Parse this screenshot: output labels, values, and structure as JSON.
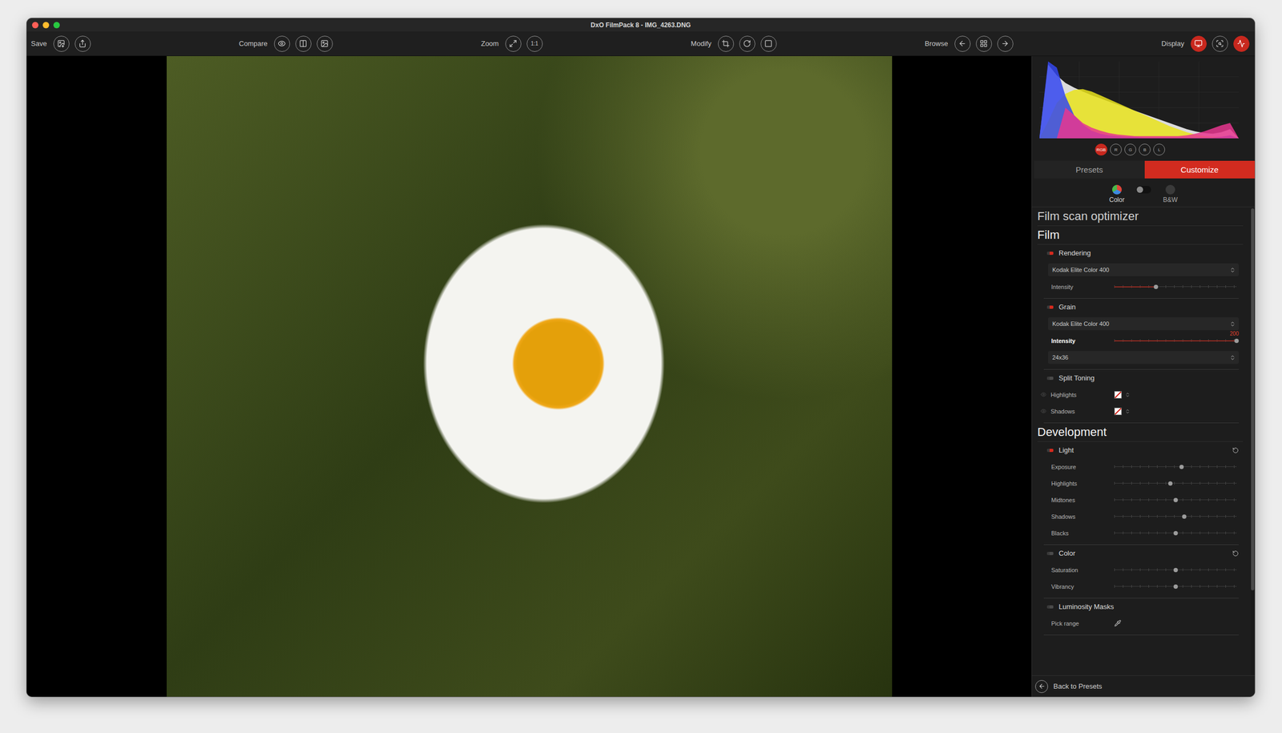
{
  "window": {
    "title": "DxO FilmPack 8 - IMG_4263.DNG"
  },
  "toolbar": {
    "groups": [
      {
        "label": "Save",
        "buttons": [
          {
            "text": "",
            "active": false
          },
          {
            "text": "",
            "active": false
          }
        ]
      },
      {
        "label": "Compare",
        "buttons": [
          {
            "text": "",
            "active": false
          },
          {
            "text": "",
            "active": false
          },
          {
            "text": "",
            "active": false
          }
        ]
      },
      {
        "label": "Zoom",
        "buttons": [
          {
            "text": "",
            "active": false
          },
          {
            "text": "1:1",
            "active": false
          }
        ]
      },
      {
        "label": "Modify",
        "buttons": [
          {
            "text": "",
            "active": false
          },
          {
            "text": "",
            "active": false
          },
          {
            "text": "",
            "active": false
          }
        ]
      },
      {
        "label": "Browse",
        "buttons": [
          {
            "text": "",
            "active": false
          },
          {
            "text": "",
            "active": false
          },
          {
            "text": "",
            "active": false
          }
        ]
      },
      {
        "label": "Display",
        "buttons": [
          {
            "text": "",
            "active": true
          },
          {
            "text": "",
            "active": false
          },
          {
            "text": "",
            "active": true
          }
        ]
      }
    ]
  },
  "histogram": {
    "series": [
      {
        "color": "#e6e6e6",
        "values": [
          0,
          96,
          82,
          72,
          66,
          61,
          56,
          52,
          48,
          44,
          40,
          36,
          32,
          28,
          24,
          20,
          16,
          12,
          9,
          7,
          6,
          8,
          12,
          0
        ]
      },
      {
        "color": "#e9e31c",
        "values": [
          0,
          22,
          46,
          58,
          63,
          64,
          61,
          56,
          51,
          46,
          41,
          36,
          31,
          26,
          21,
          16,
          12,
          8,
          5,
          3,
          2,
          2,
          2,
          0
        ]
      },
      {
        "color": "#3447f0",
        "values": [
          2,
          100,
          92,
          55,
          30,
          18,
          10,
          6,
          4,
          3,
          2,
          2,
          1,
          1,
          1,
          1,
          1,
          1,
          1,
          1,
          1,
          2,
          4,
          0
        ]
      },
      {
        "color": "#e8368f",
        "values": [
          0,
          0,
          0,
          40,
          30,
          20,
          14,
          10,
          7,
          5,
          4,
          3,
          3,
          3,
          3,
          3,
          3,
          4,
          6,
          9,
          13,
          17,
          20,
          0
        ]
      }
    ],
    "channels": [
      {
        "label": "RGB",
        "selected": true
      },
      {
        "label": "R",
        "selected": false
      },
      {
        "label": "G",
        "selected": false
      },
      {
        "label": "B",
        "selected": false
      },
      {
        "label": "L",
        "selected": false
      }
    ]
  },
  "tabs": [
    {
      "label": "Presets",
      "selected": false
    },
    {
      "label": "Customize",
      "selected": true
    }
  ],
  "mode": [
    {
      "label": "Color",
      "selected": true
    },
    {
      "label": "B&W",
      "selected": false
    }
  ],
  "sections": [
    {
      "title": "Film scan optimizer",
      "expanded": false,
      "groups": []
    },
    {
      "title": "Film",
      "expanded": true,
      "groups": [
        {
          "title": "Rendering",
          "enabled": true,
          "resettable": false,
          "rows": [
            {
              "kind": "select",
              "label": "",
              "value": "Kodak Elite Color 400"
            },
            {
              "kind": "slider",
              "label": "Intensity",
              "level": 0.34,
              "reading": "",
              "emphasized": false
            }
          ]
        },
        {
          "title": "Grain",
          "enabled": true,
          "resettable": false,
          "rows": [
            {
              "kind": "select",
              "label": "",
              "value": "Kodak Elite Color 400"
            },
            {
              "kind": "slider",
              "label": "Intensity",
              "level": 1,
              "reading": "200",
              "emphasized": true
            },
            {
              "kind": "select",
              "label": "",
              "value": "24x36"
            }
          ]
        },
        {
          "title": "Split Toning",
          "enabled": false,
          "resettable": false,
          "rows": [
            {
              "kind": "color",
              "label": "Highlights"
            },
            {
              "kind": "color",
              "label": "Shadows"
            }
          ]
        }
      ]
    },
    {
      "title": "Development",
      "expanded": true,
      "groups": [
        {
          "title": "Light",
          "enabled": true,
          "resettable": true,
          "rows": [
            {
              "kind": "centered-slider",
              "label": "Exposure",
              "level": 0.55,
              "reading": "",
              "emphasized": false
            },
            {
              "kind": "centered-slider",
              "label": "Highlights",
              "level": 0.46,
              "reading": "",
              "emphasized": false
            },
            {
              "kind": "centered-slider",
              "label": "Midtones",
              "level": 0.5,
              "reading": "",
              "emphasized": false
            },
            {
              "kind": "centered-slider",
              "label": "Shadows",
              "level": 0.57,
              "reading": "",
              "emphasized": false
            },
            {
              "kind": "centered-slider",
              "label": "Blacks",
              "level": 0.5,
              "reading": "",
              "emphasized": false
            }
          ]
        },
        {
          "title": "Color",
          "enabled": false,
          "resettable": true,
          "rows": [
            {
              "kind": "centered-slider",
              "label": "Saturation",
              "level": 0.5,
              "reading": "",
              "emphasized": false
            },
            {
              "kind": "centered-slider",
              "label": "Vibrancy",
              "level": 0.5,
              "reading": "",
              "emphasized": false
            }
          ]
        },
        {
          "title": "Luminosity Masks",
          "enabled": false,
          "resettable": false,
          "rows": [
            {
              "kind": "picker",
              "label": "Pick range"
            }
          ]
        }
      ]
    }
  ],
  "footer": {
    "label": "Back to Presets"
  }
}
